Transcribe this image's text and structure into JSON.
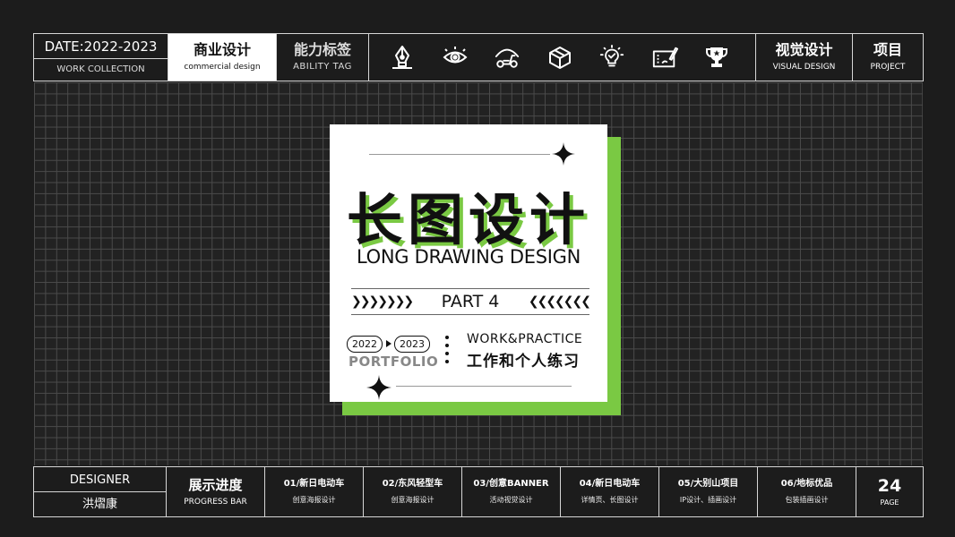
{
  "header": {
    "date": "DATE:2022-2023",
    "work_collection": "WORK COLLECTION",
    "business_cn": "商业设计",
    "business_en": "commercial design",
    "ability_cn": "能力标签",
    "ability_en": "ABILITY TAG",
    "icons": [
      "pen-tool-icon",
      "eye-icon",
      "scooter-icon",
      "box-icon",
      "lightbulb-icon",
      "tablet-drawing-icon",
      "trophy-icon"
    ],
    "visual_cn": "视觉设计",
    "visual_en": "VISUAL DESIGN",
    "project_cn": "项目",
    "project_en": "PROJECT"
  },
  "card": {
    "title_cn": "长图设计",
    "title_en": "LONG DRAWING DESIGN",
    "part": "PART 4",
    "year_start": "2022",
    "year_end": "2023",
    "portfolio": "PORTFOLIO",
    "work_en": "WORK&PRACTICE",
    "work_cn": "工作和个人练习",
    "accent_color": "#7ac943"
  },
  "footer": {
    "designer_label": "DESIGNER",
    "designer_name": "洪熠康",
    "progress_cn": "展示进度",
    "progress_en": "PROGRESS BAR",
    "items": [
      {
        "title": "01/新日电动车",
        "sub": "创意海报设计"
      },
      {
        "title": "02/东风轻型车",
        "sub": "创意海报设计"
      },
      {
        "title": "03/创意BANNER",
        "sub": "活动视觉设计"
      },
      {
        "title": "04/新日电动车",
        "sub": "详情页、长图设计"
      },
      {
        "title": "05/大别山项目",
        "sub": "IP设计、插画设计"
      },
      {
        "title": "06/地标优品",
        "sub": "包装插画设计"
      }
    ],
    "page_number": "24",
    "page_label": "PAGE"
  }
}
